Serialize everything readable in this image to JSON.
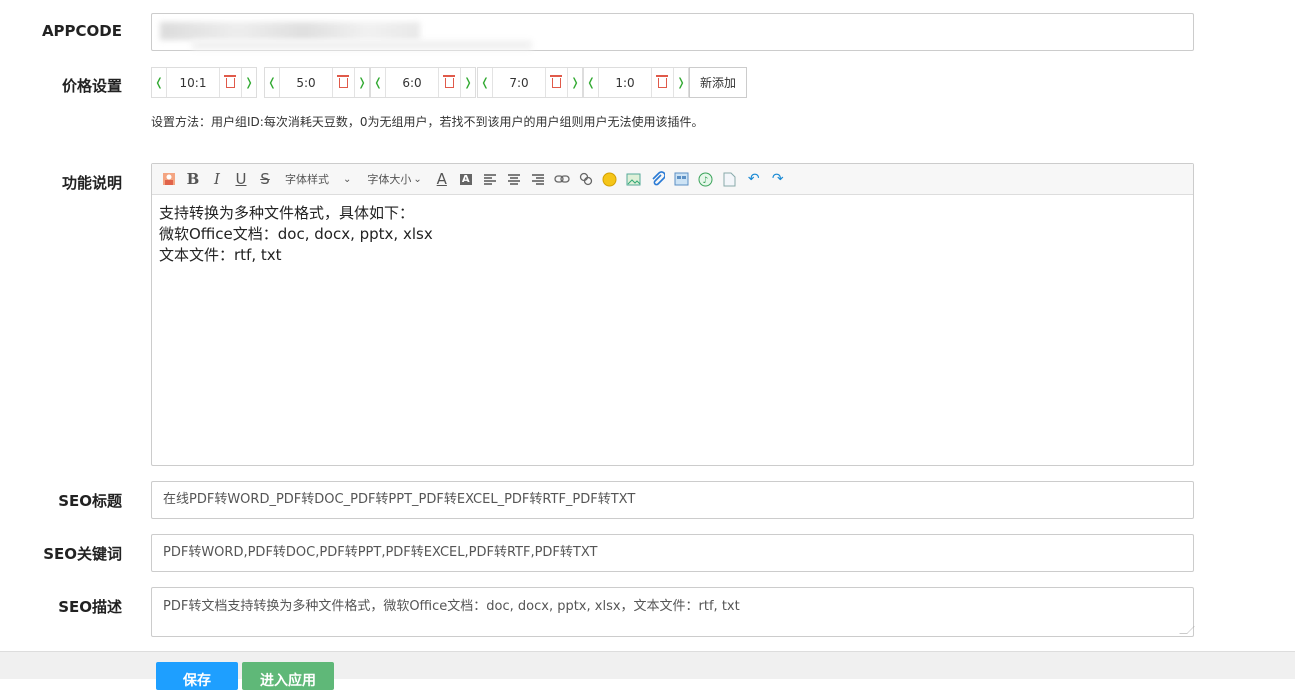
{
  "appcode": {
    "label": "APPCODE",
    "value": ""
  },
  "price": {
    "label": "价格设置",
    "items": [
      "10:1",
      "5:0",
      "6:0",
      "7:0",
      "1:0"
    ],
    "add_label": "新添加",
    "hint": "设置方法：用户组ID:每次消耗天豆数，0为无组用户，若找不到该用户的用户组则用户无法使用该插件。"
  },
  "description": {
    "label": "功能说明",
    "toolbar": {
      "font_style": "字体样式",
      "font_size": "字体大小"
    },
    "lines": [
      "支持转换为多种文件格式，具体如下：",
      "微软Office文档：doc, docx, pptx, xlsx",
      "文本文件：rtf, txt"
    ]
  },
  "seo_title": {
    "label": "SEO标题",
    "value": "在线PDF转WORD_PDF转DOC_PDF转PPT_PDF转EXCEL_PDF转RTF_PDF转TXT"
  },
  "seo_keywords": {
    "label": "SEO关键词",
    "value": "PDF转WORD,PDF转DOC,PDF转PPT,PDF转EXCEL,PDF转RTF,PDF转TXT"
  },
  "seo_desc": {
    "label": "SEO描述",
    "value": "PDF转文档支持转换为多种文件格式，微软Office文档：doc, docx, pptx, xlsx，文本文件：rtf, txt"
  },
  "footer": {
    "save_label": "保存",
    "enter_label": "进入应用"
  },
  "colors": {
    "save": "#1e9fff",
    "enter": "#5fb878",
    "arrow": "#33aa33",
    "trash": "#e05a4a"
  }
}
